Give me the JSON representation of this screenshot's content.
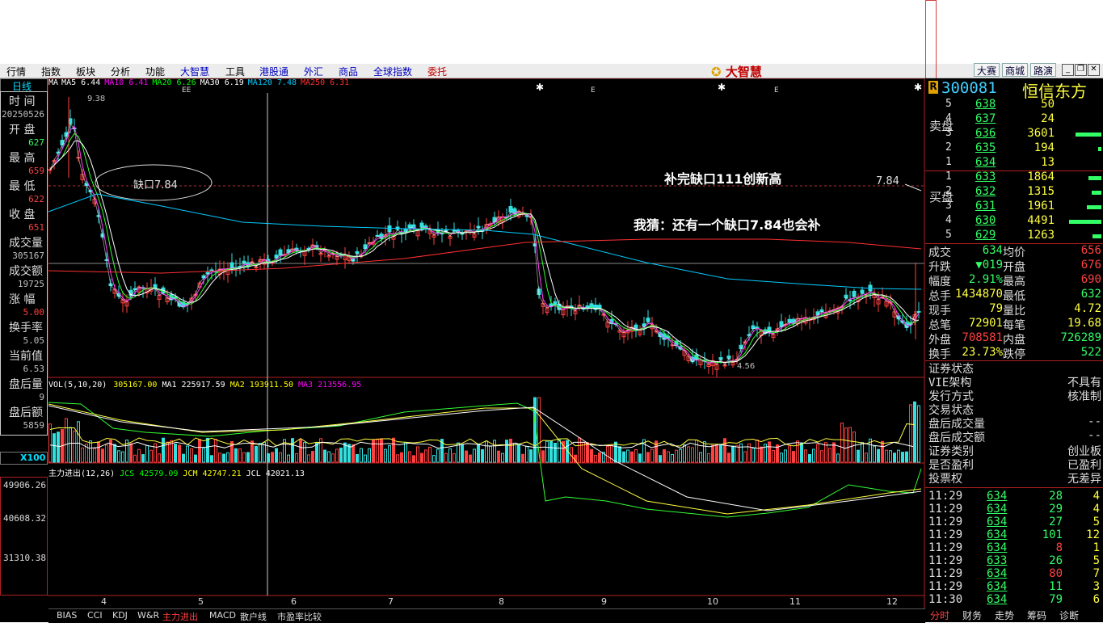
{
  "menu": {
    "items": [
      "行情",
      "指数",
      "板块",
      "分析",
      "功能",
      "大智慧",
      "工具",
      "港股通",
      "外汇",
      "商品",
      "全球指数",
      "委托"
    ],
    "logo": "大智慧",
    "top_buttons": [
      "大赛",
      "商城",
      "路演"
    ]
  },
  "period_label": "日线",
  "ma_legend": {
    "prefix": "MA",
    "items": [
      {
        "text": "MA5 6.44",
        "color": "#ffffff"
      },
      {
        "text": "MA10 6.41",
        "color": "#ff00ff"
      },
      {
        "text": "MA20 6.26",
        "color": "#00ff00"
      },
      {
        "text": "MA30 6.19",
        "color": "#ffffff"
      },
      {
        "text": "MA120 7.48",
        "color": "#00ccff"
      },
      {
        "text": "MA250 6.31",
        "color": "#ff3030"
      }
    ]
  },
  "left_info": [
    {
      "label": "时  间",
      "value": "20250526",
      "color": "#c0c0c0"
    },
    {
      "label": "开  盘",
      "value": "627",
      "color": "#33ff66"
    },
    {
      "label": "最  高",
      "value": "659",
      "color": "#ff4040"
    },
    {
      "label": "最  低",
      "value": "622",
      "color": "#ff4040"
    },
    {
      "label": "收  盘",
      "value": "651",
      "color": "#ff4040"
    },
    {
      "label": "成交量",
      "value": "305167",
      "color": "#c0c0c0"
    },
    {
      "label": "成交额",
      "value": "19725",
      "color": "#c0c0c0"
    },
    {
      "label": "涨  幅",
      "value": "5.00",
      "color": "#ff4040"
    },
    {
      "label": "换手率",
      "value": "5.05",
      "color": "#c0c0c0"
    },
    {
      "label": "当前值",
      "value": "6.53",
      "color": "#c0c0c0"
    },
    {
      "label": "盘后量",
      "value": "9",
      "color": "#c0c0c0"
    },
    {
      "label": "盘后额",
      "value": "5859",
      "color": "#c0c0c0"
    }
  ],
  "chart_annotations": {
    "gap_ellipse": "缺口7.84",
    "headline": "补完缺口111创新高",
    "guess": "我猜：还有一个缺口7.84也会补",
    "gap_value": "7.84",
    "high_label": "9.38",
    "low_label": "4.56",
    "ee_marks": [
      "EE",
      "E",
      "E"
    ]
  },
  "volume_legend": {
    "title": "VOL(5,10,20)",
    "items": [
      {
        "text": "305167.00",
        "color": "#ffff00"
      },
      {
        "text": "MA1 225917.59",
        "color": "#ffffff"
      },
      {
        "text": "MA2 193911.50",
        "color": "#ffff00"
      },
      {
        "text": "MA3 213556.95",
        "color": "#ff00ff"
      }
    ],
    "multiplier": "X100"
  },
  "indicator_legend": {
    "title": "主力进出(12,26)",
    "items": [
      {
        "text": "JCS 42579.09",
        "color": "#00ff00"
      },
      {
        "text": "JCM 42747.21",
        "color": "#ffff00"
      },
      {
        "text": "JCL 42021.13",
        "color": "#ffffff"
      }
    ]
  },
  "indicator_axis": [
    "49906.26",
    "40608.32",
    "31310.38"
  ],
  "x_axis_months": [
    "4",
    "5",
    "6",
    "7",
    "8",
    "9",
    "10",
    "11",
    "12"
  ],
  "bottom_tabs": [
    "BIAS",
    "CCI",
    "KDJ",
    "W&R",
    "主力进出",
    "MACD",
    "散户线",
    "市盈率比较"
  ],
  "quote": {
    "badge": "R",
    "code": "300081",
    "name": "恒信东方",
    "sell_label": "卖盘",
    "buy_label": "买盘",
    "sell": [
      {
        "lvl": "5",
        "price": "638",
        "vol": "50",
        "bar": 0
      },
      {
        "lvl": "4",
        "price": "637",
        "vol": "24",
        "bar": 0
      },
      {
        "lvl": "3",
        "price": "636",
        "vol": "3601",
        "bar": 0.8
      },
      {
        "lvl": "2",
        "price": "635",
        "vol": "194",
        "bar": 0.1
      },
      {
        "lvl": "1",
        "price": "634",
        "vol": "13",
        "bar": 0
      }
    ],
    "buy": [
      {
        "lvl": "1",
        "price": "633",
        "vol": "1864",
        "bar": 0.4
      },
      {
        "lvl": "2",
        "price": "632",
        "vol": "1315",
        "bar": 0.3
      },
      {
        "lvl": "3",
        "price": "631",
        "vol": "1961",
        "bar": 0.45
      },
      {
        "lvl": "4",
        "price": "630",
        "vol": "4491",
        "bar": 1.0
      },
      {
        "lvl": "5",
        "price": "629",
        "vol": "1263",
        "bar": 0.28
      }
    ],
    "stats": [
      {
        "l1": "成交",
        "v1": "634",
        "c1": "#33ff66",
        "l2": "均价",
        "v2": "656",
        "c2": "#ff4040"
      },
      {
        "l1": "升跌",
        "v1": "▼019",
        "c1": "#33ff66",
        "l2": "开盘",
        "v2": "676",
        "c2": "#ff4040"
      },
      {
        "l1": "幅度",
        "v1": "2.91%",
        "c1": "#33ff66",
        "l2": "最高",
        "v2": "690",
        "c2": "#ff4040"
      },
      {
        "l1": "总手",
        "v1": "1434870",
        "c1": "#ffff40",
        "l2": "最低",
        "v2": "632",
        "c2": "#33ff66"
      },
      {
        "l1": "现手",
        "v1": "79",
        "c1": "#ffff40",
        "l2": "量比",
        "v2": "4.72",
        "c2": "#ffff40"
      },
      {
        "l1": "总笔",
        "v1": "72901",
        "c1": "#ffff40",
        "l2": "每笔",
        "v2": "19.68",
        "c2": "#ffff40"
      },
      {
        "l1": "外盘",
        "v1": "708581",
        "c1": "#ff4040",
        "l2": "内盘",
        "v2": "726289",
        "c2": "#33ff66"
      },
      {
        "l1": "换手",
        "v1": "23.73%",
        "c1": "#ffff40",
        "l2": "跌停",
        "v2": "522",
        "c2": "#33ff66"
      }
    ],
    "status": [
      {
        "k": "证券状态",
        "v": ""
      },
      {
        "k": "VIE架构",
        "v": "不具有"
      },
      {
        "k": "发行方式",
        "v": "核准制"
      },
      {
        "k": "交易状态",
        "v": ""
      },
      {
        "k": "盘后成交量",
        "v": "--"
      },
      {
        "k": "盘后成交额",
        "v": "--"
      },
      {
        "k": "证券类别",
        "v": "创业板"
      },
      {
        "k": "是否盈利",
        "v": "已盈利"
      },
      {
        "k": "投票权",
        "v": "无差异"
      }
    ],
    "ticks": [
      {
        "t": "11:29",
        "p": "634",
        "pc": "#33ff66",
        "v": "28",
        "vc": "#33ff66",
        "n": "4"
      },
      {
        "t": "11:29",
        "p": "634",
        "pc": "#33ff66",
        "v": "29",
        "vc": "#33ff66",
        "n": "4"
      },
      {
        "t": "11:29",
        "p": "634",
        "pc": "#33ff66",
        "v": "27",
        "vc": "#33ff66",
        "n": "5"
      },
      {
        "t": "11:29",
        "p": "634",
        "pc": "#33ff66",
        "v": "101",
        "vc": "#33ff66",
        "n": "12"
      },
      {
        "t": "11:29",
        "p": "634",
        "pc": "#33ff66",
        "v": "8",
        "vc": "#ff4040",
        "n": "1"
      },
      {
        "t": "11:29",
        "p": "633",
        "pc": "#33ff66",
        "v": "26",
        "vc": "#33ff66",
        "n": "5"
      },
      {
        "t": "11:29",
        "p": "634",
        "pc": "#33ff66",
        "v": "80",
        "vc": "#ff4040",
        "n": "7"
      },
      {
        "t": "11:29",
        "p": "634",
        "pc": "#33ff66",
        "v": "11",
        "vc": "#33ff66",
        "n": "3"
      },
      {
        "t": "11:30",
        "p": "634",
        "pc": "#33ff66",
        "v": "79",
        "vc": "#33ff66",
        "n": "6"
      }
    ],
    "tabs": [
      "分时",
      "财务",
      "走势",
      "筹码",
      "诊断"
    ]
  }
}
